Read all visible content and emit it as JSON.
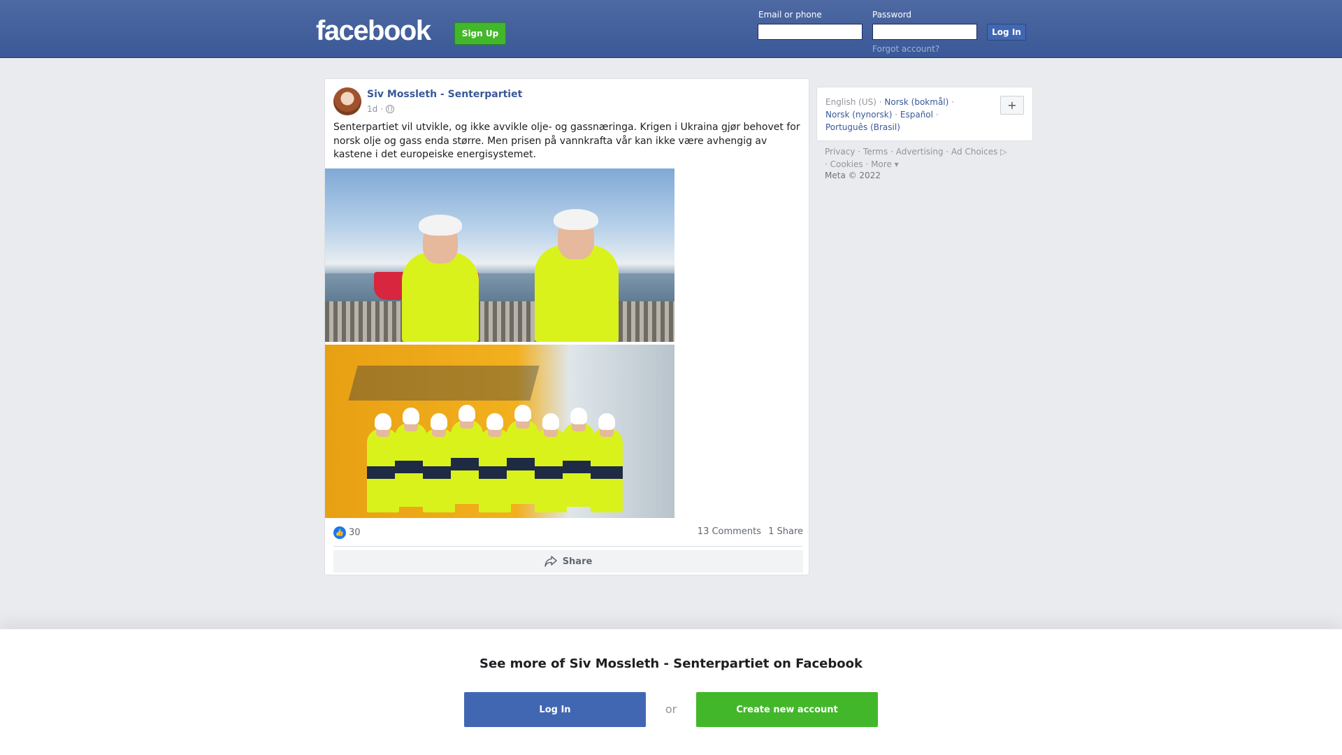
{
  "header": {
    "logo": "facebook",
    "signup_label": "Sign Up",
    "email_label": "Email or phone",
    "password_label": "Password",
    "login_label": "Log In",
    "forgot_label": "Forgot account?"
  },
  "post": {
    "author": "Siv Mossleth - Senterpartiet",
    "time": "1d",
    "time_sep": "·",
    "text": "Senterpartiet vil utvikle, og ikke avvikle olje- og gassnæringa. Krigen i Ukraina gjør behovet for norsk olje og gass enda større. Men prisen på vannkrafta vår kan ikke være avhengig av kastene i det europeiske energisystemet.",
    "likes": "30",
    "comments": "13 Comments",
    "shares": "1 Share",
    "share_label": "Share"
  },
  "sidebar": {
    "current_language": "English (US)",
    "languages": [
      "Norsk (bokmål)",
      "Norsk (nynorsk)",
      "Español",
      "Português (Brasil)"
    ],
    "plus_label": "+",
    "footer_links": [
      "Privacy",
      "Terms",
      "Advertising",
      "Ad Choices",
      "Cookies",
      "More"
    ],
    "copyright": "Meta © 2022"
  },
  "bottom": {
    "title": "See more of Siv Mossleth - Senterpartiet on Facebook",
    "login_label": "Log In",
    "or_label": "or",
    "create_label": "Create new account"
  },
  "colors": {
    "brand_blue": "#4267b2",
    "green": "#42b72a",
    "link": "#385898"
  }
}
